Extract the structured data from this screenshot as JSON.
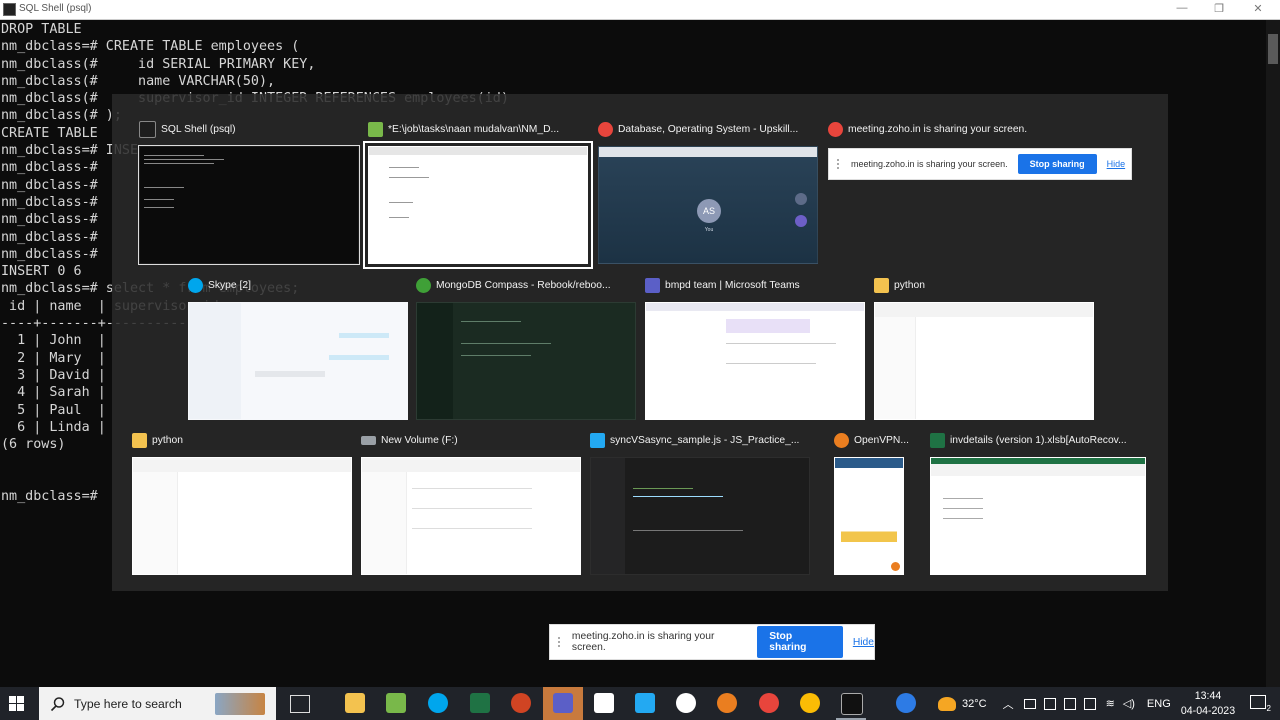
{
  "window": {
    "title": "SQL Shell (psql)",
    "controls": [
      "—",
      "❐",
      "✕"
    ]
  },
  "console": {
    "lines": [
      "DROP TABLE",
      "nm_dbclass=# CREATE TABLE employees (",
      "nm_dbclass(#     id SERIAL PRIMARY KEY,",
      "nm_dbclass(#     name VARCHAR(50),",
      "nm_dbclass(#     supervisor_id INTEGER REFERENCES employees(id)",
      "nm_dbclass(# );",
      "CREATE TABLE",
      "nm_dbclass=# INSE",
      "nm_dbclass-#",
      "nm_dbclass-#",
      "nm_dbclass-#",
      "nm_dbclass-#",
      "nm_dbclass-#",
      "nm_dbclass-#",
      "INSERT 0 6",
      "nm_dbclass=# select * from employees;",
      " id | name  | supervisor_id",
      "----+-------+--------------",
      "  1 | John  |",
      "  2 | Mary  |",
      "  3 | David |",
      "  4 | Sarah |",
      "  5 | Paul  |",
      "  6 | Linda |",
      "(6 rows)",
      "",
      "",
      "nm_dbclass=#"
    ]
  },
  "switcher": {
    "windows": [
      {
        "label": "SQL Shell (psql)",
        "icon": "cmd-icon",
        "color": "#1e1e1e"
      },
      {
        "label": "*E:\\job\\tasks\\naan mudalvan\\NM_D...",
        "icon": "notepadpp-icon",
        "color": "#79b84a"
      },
      {
        "label": "Database, Operating System - Upskill...",
        "icon": "chrome-icon",
        "color": "#e8453c"
      },
      {
        "label": "meeting.zoho.in is sharing your screen.",
        "icon": "chrome-icon",
        "color": "#e8453c"
      },
      {
        "label": "Skype [2]",
        "icon": "skype-icon",
        "color": "#00a6ed"
      },
      {
        "label": "MongoDB Compass - Rebook/reboo...",
        "icon": "mongodb-icon",
        "color": "#3fa037"
      },
      {
        "label": "bmpd team | Microsoft Teams",
        "icon": "teams-icon",
        "color": "#5b5fc7"
      },
      {
        "label": "python",
        "icon": "folder-icon",
        "color": "#f3c24f"
      },
      {
        "label": "python",
        "icon": "folder-icon",
        "color": "#f3c24f"
      },
      {
        "label": "New Volume (F:)",
        "icon": "drive-icon",
        "color": "#9aa0a6"
      },
      {
        "label": "syncVSasync_sample.js - JS_Practice_...",
        "icon": "vscode-icon",
        "color": "#23a9f2"
      },
      {
        "label": "OpenVPN...",
        "icon": "openvpn-icon",
        "color": "#ea7e20"
      },
      {
        "label": "invdetails (version 1).xlsb[AutoRecov...",
        "icon": "excel-icon",
        "color": "#1f7244"
      }
    ],
    "call": {
      "avatar": "AS",
      "name": "You"
    }
  },
  "share_bar_thumb": {
    "message": "meeting.zoho.in is sharing your screen.",
    "stop": "Stop sharing",
    "hide": "Hide"
  },
  "share_bar": {
    "message": "meeting.zoho.in is sharing your screen.",
    "stop": "Stop sharing",
    "hide": "Hide"
  },
  "taskbar": {
    "search_placeholder": "Type here to search",
    "weather": "32°C",
    "language": "ENG",
    "time": "13:44",
    "date": "04-04-2023",
    "notification_count": "2"
  }
}
